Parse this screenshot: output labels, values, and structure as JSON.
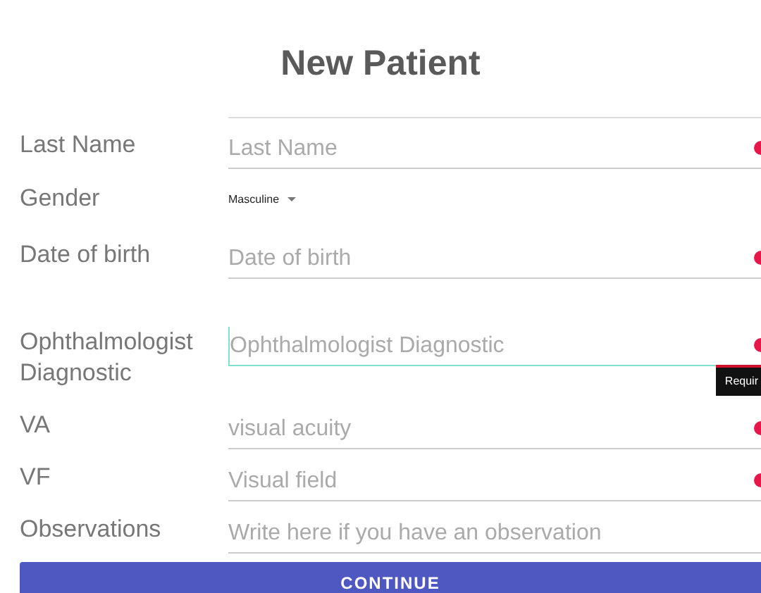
{
  "title": "New Patient",
  "fields": [
    {
      "kind": "text",
      "label": "Last Name",
      "placeholder": "Last Name",
      "required": true,
      "focused": false
    },
    {
      "kind": "select",
      "label": "Gender",
      "value": "Masculine"
    },
    {
      "kind": "text",
      "label": "Date of birth",
      "placeholder": "Date of birth",
      "required": true,
      "focused": false
    },
    {
      "kind": "text",
      "label": "Ophthalmologist Diagnostic",
      "placeholder": "Ophthalmologist Diagnostic",
      "required": true,
      "focused": true,
      "error": "Requir"
    },
    {
      "kind": "text",
      "label": "VA",
      "placeholder": "visual acuity",
      "required": true,
      "focused": false
    },
    {
      "kind": "text",
      "label": "VF",
      "placeholder": "Visual field",
      "required": true,
      "focused": false
    },
    {
      "kind": "text",
      "label": "Observations",
      "placeholder": "Write here if you have an observation",
      "required": false,
      "focused": false
    }
  ],
  "button": "CONTINUE"
}
